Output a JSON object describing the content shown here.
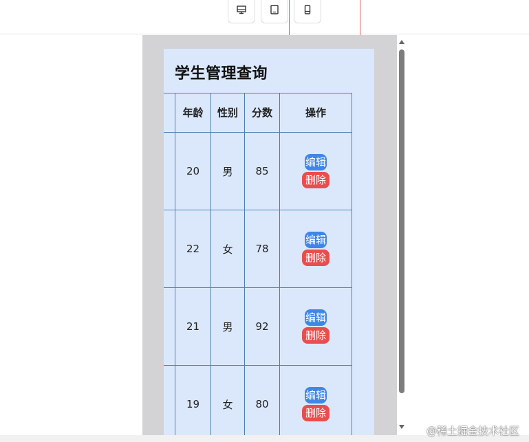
{
  "devices": [
    {
      "name": "desktop",
      "icon": "desktop-icon"
    },
    {
      "name": "tablet",
      "icon": "tablet-icon"
    },
    {
      "name": "mobile",
      "icon": "mobile-icon"
    }
  ],
  "page": {
    "title": "学生管理查询",
    "headers": {
      "col0": "",
      "age": "年龄",
      "gender": "性别",
      "score": "分数",
      "actions": "操作"
    },
    "rows": [
      {
        "age": "20",
        "gender": "男",
        "score": "85"
      },
      {
        "age": "22",
        "gender": "女",
        "score": "78"
      },
      {
        "age": "21",
        "gender": "男",
        "score": "92"
      },
      {
        "age": "19",
        "gender": "女",
        "score": "80"
      }
    ],
    "edit_label": "编辑",
    "delete_label": "删除"
  },
  "watermark": "@稀土掘金技术社区",
  "colors": {
    "edit": "#3f86e8",
    "delete": "#e94e4e",
    "card": "#dbe8fb",
    "border": "#4a7fb0"
  }
}
